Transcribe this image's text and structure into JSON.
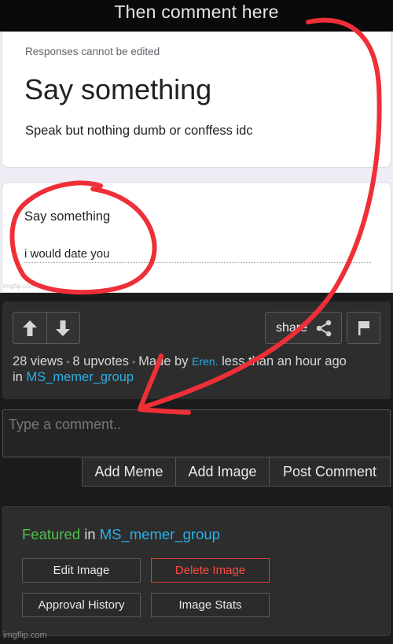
{
  "meme": {
    "caption": "Then comment here",
    "form": {
      "note": "Responses cannot be edited",
      "title": "Say something",
      "description": "Speak but nothing dumb or conffess idc",
      "question_label": "Say something",
      "answer": "i would date you"
    },
    "watermark": "imgflip.com"
  },
  "post": {
    "share_label": "share",
    "views": "28 views",
    "upvotes": "8 upvotes",
    "made_by_prefix": "Made by",
    "author": "Eren.",
    "time": "less than an hour ago",
    "in_label": "in",
    "group": "MS_memer_group"
  },
  "comment": {
    "placeholder": "Type a comment..",
    "add_meme": "Add Meme",
    "add_image": "Add Image",
    "post_comment": "Post Comment"
  },
  "feature": {
    "featured_word": "Featured",
    "in_label": "in",
    "group": "MS_memer_group",
    "edit_image": "Edit Image",
    "delete_image": "Delete Image",
    "approval_history": "Approval History",
    "image_stats": "Image Stats"
  },
  "watermark_bottom": "imgflip.com",
  "colors": {
    "annotation_red": "#ef2f38",
    "link_blue": "#2ab0e8",
    "featured_green": "#4cc24c",
    "delete_red": "#ff4a3f"
  },
  "icons": [
    "arrow-up-icon",
    "arrow-down-icon",
    "share-icon",
    "flag-icon"
  ]
}
